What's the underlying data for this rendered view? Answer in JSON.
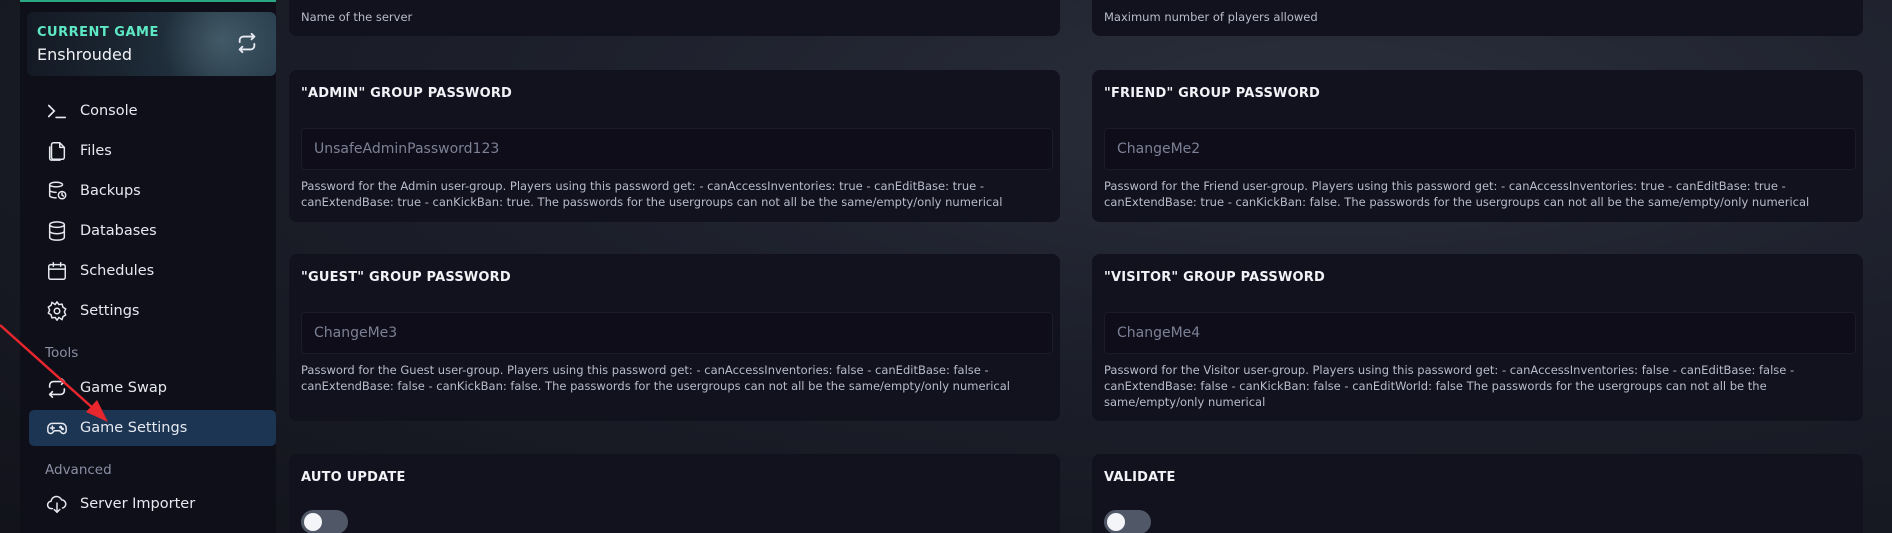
{
  "sidebar": {
    "current_game": {
      "label": "CURRENT GAME",
      "name": "Enshrouded"
    },
    "items": [
      {
        "label": "Console",
        "icon": "terminal-icon"
      },
      {
        "label": "Files",
        "icon": "files-icon"
      },
      {
        "label": "Backups",
        "icon": "backups-icon"
      },
      {
        "label": "Databases",
        "icon": "database-icon"
      },
      {
        "label": "Schedules",
        "icon": "calendar-icon"
      },
      {
        "label": "Settings",
        "icon": "gear-icon"
      }
    ],
    "tools_label": "Tools",
    "tools": [
      {
        "label": "Game Swap",
        "icon": "swap-icon"
      },
      {
        "label": "Game Settings",
        "icon": "gamepad-icon",
        "active": true
      }
    ],
    "advanced_label": "Advanced",
    "advanced": [
      {
        "label": "Server Importer",
        "icon": "cloud-download-icon"
      }
    ]
  },
  "top_cards": {
    "left_desc": "Name of the server",
    "right_desc": "Maximum number of players allowed"
  },
  "cards": {
    "admin": {
      "title": "\"ADMIN\" GROUP PASSWORD",
      "value": "UnsafeAdminPassword123",
      "description": "Password for the Admin user-group. Players using this password get: - canAccessInventories: true - canEditBase: true - canExtendBase: true - canKickBan: true. The passwords for the usergroups can not all be the same/empty/only numerical"
    },
    "friend": {
      "title": "\"FRIEND\" GROUP PASSWORD",
      "value": "ChangeMe2",
      "description": "Password for the Friend user-group. Players using this password get: - canAccessInventories: true - canEditBase: true - canExtendBase: true - canKickBan: false. The passwords for the usergroups can not all be the same/empty/only numerical"
    },
    "guest": {
      "title": "\"GUEST\" GROUP PASSWORD",
      "value": "ChangeMe3",
      "description": "Password for the Guest user-group. Players using this password get: - canAccessInventories: false - canEditBase: false - canExtendBase: false - canKickBan: false. The passwords for the usergroups can not all be the same/empty/only numerical"
    },
    "visitor": {
      "title": "\"VISITOR\" GROUP PASSWORD",
      "value": "ChangeMe4",
      "description": "Password for the Visitor user-group. Players using this password get: - canAccessInventories: false - canEditBase: false - canExtendBase: false - canKickBan: false - canEditWorld: false The passwords for the usergroups can not all be the same/empty/only numerical"
    },
    "auto_update": {
      "title": "AUTO UPDATE",
      "enabled": false
    },
    "validate": {
      "title": "VALIDATE",
      "enabled": false
    }
  },
  "colors": {
    "accent": "#5ee8c4",
    "active_nav": "#1b3552",
    "card_bg": "#12111e",
    "annotation_arrow": "#e8262e"
  }
}
